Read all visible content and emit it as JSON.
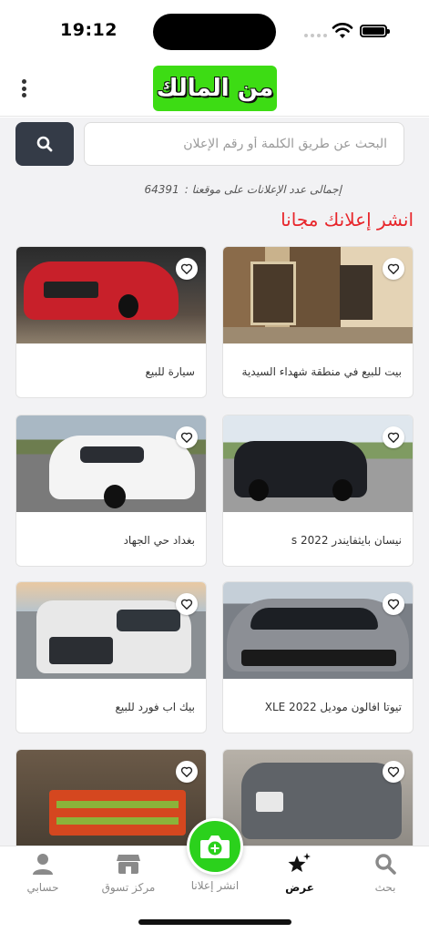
{
  "status_bar": {
    "time": "19:12"
  },
  "header": {
    "logo_text": "من المالك",
    "brand_color": "#3ddc14"
  },
  "search": {
    "placeholder": "البحث عن طريق الكلمة أو رقم الإعلان",
    "button_icon": "search-icon"
  },
  "ads": {
    "count_label": "إجمالى عدد الإعلانات على موقعنا :",
    "count_value": "64391"
  },
  "post_free_label": "انشر إعلانك مجانا",
  "listings": [
    {
      "title": "بيت للبيع في منطقة شهداء السيدية",
      "favorite_icon": "heart-icon"
    },
    {
      "title": "سيارة للبيع",
      "favorite_icon": "heart-icon"
    },
    {
      "title": "نيسان بايثفايندر 2022 s",
      "favorite_icon": "heart-icon"
    },
    {
      "title": "بغداد حي الجهاد",
      "favorite_icon": "heart-icon"
    },
    {
      "title": "تيوتا افالون موديل XLE 2022",
      "favorite_icon": "heart-icon"
    },
    {
      "title": "بيك اب فورد للبيع",
      "favorite_icon": "heart-icon"
    },
    {
      "title": "",
      "favorite_icon": "heart-icon"
    },
    {
      "title": "",
      "favorite_icon": "heart-icon"
    }
  ],
  "bottom_nav": {
    "items": [
      {
        "label": "بحث",
        "icon": "search-icon"
      },
      {
        "label": "عرض",
        "icon": "sparkle-star-icon",
        "active": true
      },
      {
        "label": "انشر إعلانا",
        "icon": "camera-plus-icon"
      },
      {
        "label": "مركز تسوق",
        "icon": "store-icon"
      },
      {
        "label": "حسابي",
        "icon": "user-icon"
      }
    ],
    "fab_color": "#2bd11c"
  }
}
